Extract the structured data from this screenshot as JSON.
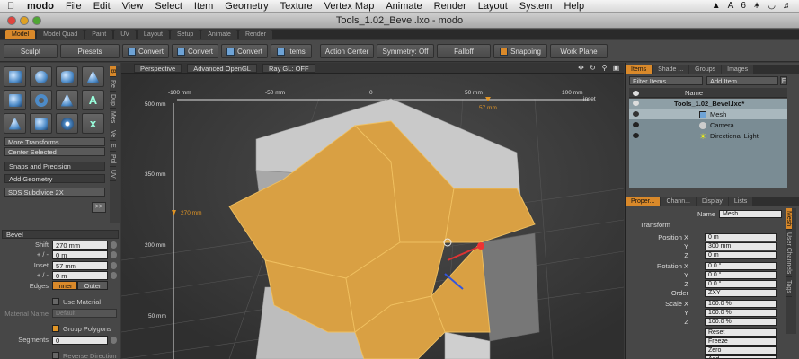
{
  "menubar": {
    "app": "modo",
    "items": [
      "File",
      "Edit",
      "View",
      "Select",
      "Item",
      "Geometry",
      "Texture",
      "Vertex Map",
      "Animate",
      "Render",
      "Layout",
      "System",
      "Help"
    ],
    "right_text": "6"
  },
  "window": {
    "title": "Tools_1.02_Bevel.lxo - modo"
  },
  "layout_tabs": [
    "Model",
    "Model Quad",
    "Paint",
    "UV",
    "Layout",
    "Setup",
    "Animate",
    "Render"
  ],
  "toolbar": {
    "sculpt": "Sculpt",
    "presets": "Presets",
    "convert1": "Convert",
    "convert2": "Convert",
    "convert3": "Convert",
    "items": "Items",
    "action_center": "Action Center",
    "symmetry": "Symmetry: Off",
    "falloff": "Falloff",
    "snapping": "Snapping",
    "work_plane": "Work Plane"
  },
  "left_panel": {
    "tabs": [
      "B",
      "Re",
      "Dup",
      "Mes",
      "Ve",
      "E",
      "Pol",
      "UV"
    ],
    "more_transforms": "More Transforms",
    "center_selected": "Center Selected",
    "snaps_precision": "Snaps and Precision",
    "add_geometry": "Add Geometry",
    "sds_subdivide": "SDS Subdivide 2X",
    "bevel": {
      "title": "Bevel",
      "shift_label": "Shift",
      "shift_value": "270 mm",
      "plusminus1_label": "+ / -",
      "plusminus1_value": "0 m",
      "inset_label": "Inset",
      "inset_value": "57 mm",
      "plusminus2_label": "+ / -",
      "plusminus2_value": "0 m",
      "edges_label": "Edges",
      "edges_inner": "Inner",
      "edges_outer": "Outer",
      "use_material": "Use Material",
      "material_name_label": "Material Name",
      "material_name_value": "Default",
      "group_polygons": "Group Polygons",
      "segments_label": "Segments",
      "segments_value": "0",
      "reverse_direction": "Reverse Direction"
    }
  },
  "viewport": {
    "perspective": "Perspective",
    "advanced_gl": "Advanced OpenGL",
    "raygl": "Ray GL: OFF",
    "ruler_top": [
      "-100 mm",
      "-50 mm",
      "0",
      "50 mm",
      "100 mm"
    ],
    "inset_label": "inset",
    "inset_value": "57 mm",
    "ruler_left": [
      "500 mm",
      "350 mm",
      "200 mm",
      "50 mm"
    ],
    "shift_value": "270 mm"
  },
  "items_panel": {
    "tabs": [
      "Items",
      "Shade ...",
      "Groups",
      "Images"
    ],
    "filter_items": "Filter Items",
    "add_item": "Add Item",
    "f_label": "F",
    "name_header": "Name",
    "scene": "Tools_1.02_Bevel.lxo*",
    "items": [
      "Mesh",
      "Camera",
      "Directional Light"
    ]
  },
  "properties_panel": {
    "tabs": [
      "Proper...",
      "Chann...",
      "Display",
      "Lists"
    ],
    "side_tabs": [
      "Mesh",
      "User Channels",
      "Tags"
    ],
    "name_label": "Name",
    "name_value": "Mesh",
    "transform": "Transform",
    "position_label": "Position X",
    "position": [
      "0 m",
      "300 mm",
      "0 m"
    ],
    "rotation_label": "Rotation X",
    "rotation": [
      "0.0 °",
      "0.0 °",
      "0.0 °"
    ],
    "order_label": "Order",
    "order_value": "ZXY",
    "scale_label": "Scale X",
    "scale": [
      "100.0 %",
      "100.0 %",
      "100.0 %"
    ],
    "axes": [
      "Y",
      "Z"
    ],
    "buttons": [
      "Reset",
      "Freeze",
      "Zero",
      "Add"
    ]
  },
  "colors": {
    "accent": "#d9892a",
    "mesh_orange": "#d9a043",
    "mesh_gray": "#cfcfcf"
  }
}
